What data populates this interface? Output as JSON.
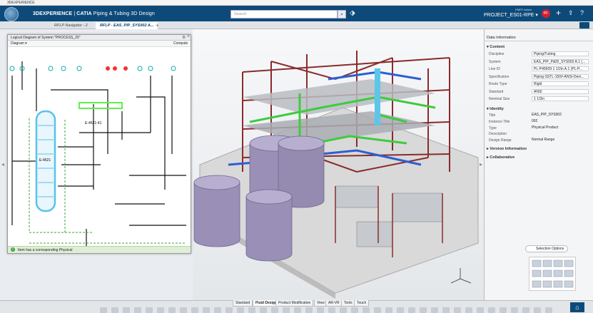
{
  "os": {
    "title": "3DEXPERIENCE"
  },
  "app": {
    "brand": "3DEXPERIENCE",
    "product": "CATIA",
    "role": "Piping & Tubing 3D Design",
    "search_placeholder": "Search",
    "user_tag": "PMPF Admin",
    "project": "PROJECT_ES01-RPE",
    "avatar_initials": "PF"
  },
  "tabs": [
    {
      "label": "RFLP Navigator - 2"
    },
    {
      "label": "RFLP - EAS_PIP_SYS002 A..."
    }
  ],
  "diagram": {
    "title": "Logical Diagram of System \"PROCESS_20\"",
    "dropdown": "Diagram",
    "compute": "Compute",
    "labels": [
      "E-4521-41",
      "E-4521"
    ],
    "status": "Item has a corresponding Physical"
  },
  "data_panel": {
    "title": "Data Information",
    "sections": {
      "content": "Content",
      "identity": "Identity",
      "version": "Version Information",
      "collab": "Collaborative"
    },
    "content_rows": [
      {
        "label": "Discipline",
        "value": "Piping/Tubing"
      },
      {
        "label": "System",
        "value": "EAS_PIP_P&ID_SYS002 A.1 (..."
      },
      {
        "label": "Line ID",
        "value": "PL-P45609-1 1/2in A.1 (PL-P..."
      },
      {
        "label": "Specification",
        "value": "Piping-SSTL-150#-ANSI-Dem..."
      },
      {
        "label": "Route Type",
        "value": "Rigid"
      },
      {
        "label": "Standard",
        "value": "ANSI"
      },
      {
        "label": "Nominal Size",
        "value": "1 1/2in"
      }
    ],
    "identity_rows": [
      {
        "label": "Title",
        "value": "EAS_PIP_SYS002"
      },
      {
        "label": "Instance Title",
        "value": "002"
      },
      {
        "label": "Type",
        "value": "Physical Product"
      },
      {
        "label": "Description",
        "value": ""
      },
      {
        "label": "Design Range",
        "value": "Normal Range"
      }
    ],
    "selection_options": "Selection Options"
  },
  "bottom_tabs": [
    "Standard",
    "Fluid Design",
    "Product Modification",
    "View",
    "AR-VR",
    "Tools",
    "Touch"
  ],
  "colors": {
    "appbar": "#0d4a7a",
    "accent": "#d5202d",
    "pipe_green": "#3ecb3e",
    "steel_red": "#8a2b2b",
    "pipe_blue": "#2b5fd1",
    "tank": "#9a8fb6"
  }
}
